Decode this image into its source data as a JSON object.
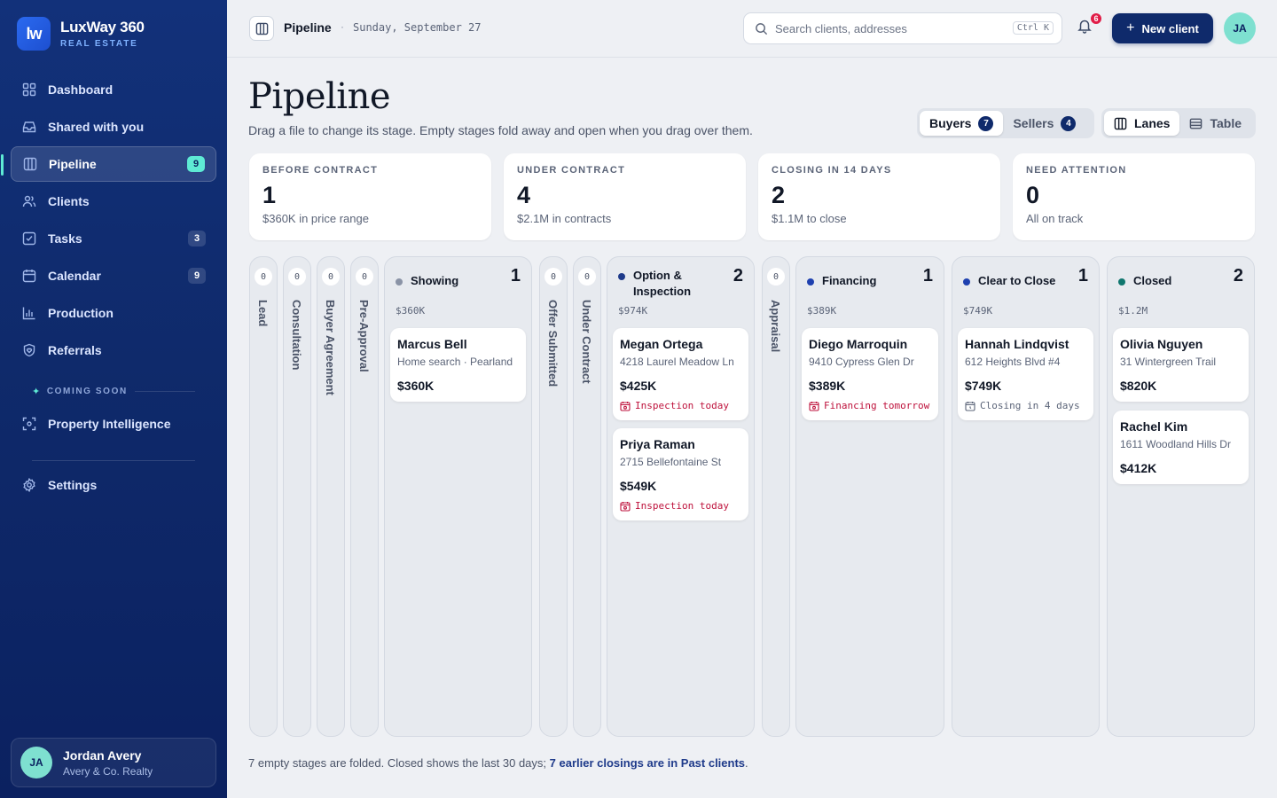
{
  "brand": {
    "name": "LuxWay 360",
    "sub": "REAL ESTATE",
    "logo": "lw"
  },
  "sidebar": {
    "items": [
      {
        "label": "Dashboard",
        "icon": "grid-icon"
      },
      {
        "label": "Shared with you",
        "icon": "inbox-icon"
      },
      {
        "label": "Pipeline",
        "icon": "columns-icon",
        "badge": "9",
        "active": true
      },
      {
        "label": "Clients",
        "icon": "users-icon"
      },
      {
        "label": "Tasks",
        "icon": "checkbox-icon",
        "badge": "3"
      },
      {
        "label": "Calendar",
        "icon": "calendar-icon",
        "badge": "9"
      },
      {
        "label": "Production",
        "icon": "bar-chart-icon"
      },
      {
        "label": "Referrals",
        "icon": "shield-heart-icon"
      }
    ],
    "coming_soon": "COMING SOON",
    "soon_items": [
      {
        "label": "Property Intelligence",
        "icon": "scan-icon"
      }
    ],
    "settings": {
      "label": "Settings",
      "icon": "gear-icon"
    },
    "user": {
      "initials": "JA",
      "name": "Jordan Avery",
      "org": "Avery & Co. Realty"
    }
  },
  "topbar": {
    "title": "Pipeline",
    "sep": "·",
    "date": "Sunday, September 27",
    "search_placeholder": "Search clients, addresses",
    "shortcut": "Ctrl K",
    "notifications": "6",
    "new_client": "New client",
    "avatar": "JA"
  },
  "page": {
    "title": "Pipeline",
    "subtitle": "Drag a file to change its stage. Empty stages fold away and open when you drag over them.",
    "audience": [
      {
        "label": "Buyers",
        "count": "7",
        "selected": true
      },
      {
        "label": "Sellers",
        "count": "4",
        "selected": false
      }
    ],
    "views": [
      {
        "label": "Lanes",
        "icon": "columns-icon",
        "selected": true
      },
      {
        "label": "Table",
        "icon": "table-icon",
        "selected": false
      }
    ]
  },
  "stats": [
    {
      "label": "BEFORE CONTRACT",
      "value": "1",
      "note": "$360K in price range"
    },
    {
      "label": "UNDER CONTRACT",
      "value": "4",
      "note": "$2.1M in contracts"
    },
    {
      "label": "CLOSING IN 14 DAYS",
      "value": "2",
      "note": "$1.1M to close"
    },
    {
      "label": "NEED ATTENTION",
      "value": "0",
      "note": "All on track"
    }
  ],
  "folded": [
    {
      "count": "0",
      "label": "Lead"
    },
    {
      "count": "0",
      "label": "Consultation"
    },
    {
      "count": "0",
      "label": "Buyer Agreement"
    },
    {
      "count": "0",
      "label": "Pre-Approval"
    },
    {
      "count": "0",
      "label": "Offer Submitted"
    },
    {
      "count": "0",
      "label": "Under Contract"
    },
    {
      "count": "0",
      "label": "Appraisal"
    }
  ],
  "lanes": [
    {
      "name": "Showing",
      "count": "1",
      "total": "$360K",
      "dot": "#8a93a6",
      "cards": [
        {
          "name": "Marcus Bell",
          "addr": "Home search · Pearland",
          "price": "$360K"
        }
      ]
    },
    {
      "name": "Option & Inspection",
      "count": "2",
      "total": "$974K",
      "dot": "#1e3a8a",
      "cards": [
        {
          "name": "Megan Ortega",
          "addr": "4218 Laurel Meadow Ln",
          "price": "$425K",
          "flag": "Inspection today"
        },
        {
          "name": "Priya Raman",
          "addr": "2715 Bellefontaine St",
          "price": "$549K",
          "flag": "Inspection today"
        }
      ]
    },
    {
      "name": "Financing",
      "count": "1",
      "total": "$389K",
      "dot": "#1e40af",
      "cards": [
        {
          "name": "Diego Marroquin",
          "addr": "9410 Cypress Glen Dr",
          "price": "$389K",
          "flag": "Financing tomorrow"
        }
      ]
    },
    {
      "name": "Clear to Close",
      "count": "1",
      "total": "$749K",
      "dot": "#1e40af",
      "cards": [
        {
          "name": "Hannah Lindqvist",
          "addr": "612 Heights Blvd #4",
          "price": "$749K",
          "flag": "Closing in 4 days"
        }
      ]
    },
    {
      "name": "Closed",
      "count": "2",
      "total": "$1.2M",
      "dot": "#0f766e",
      "cards": [
        {
          "name": "Olivia Nguyen",
          "addr": "31 Wintergreen Trail",
          "price": "$820K"
        },
        {
          "name": "Rachel Kim",
          "addr": "1611 Woodland Hills Dr",
          "price": "$412K"
        }
      ]
    }
  ],
  "footer": {
    "text": "7 empty stages are folded. Closed shows the last 30 days; ",
    "link": "7 earlier closings are in Past clients",
    "end": "."
  },
  "colors": {
    "sidebar": "#0f2a6b",
    "accent": "#5eead4",
    "alert": "#be123c"
  }
}
